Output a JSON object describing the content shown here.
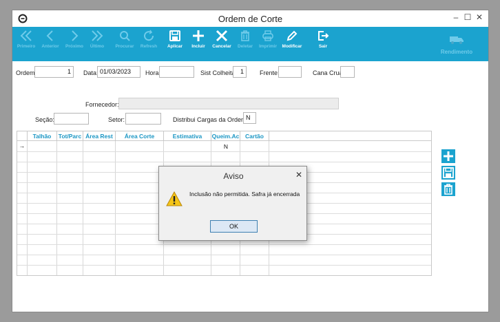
{
  "window": {
    "title": "Ordem de Corte"
  },
  "toolbar": {
    "buttons": [
      {
        "label": "Primeiro",
        "icon": "double-chevron-left-icon",
        "enabled": false
      },
      {
        "label": "Anterior",
        "icon": "chevron-left-icon",
        "enabled": false
      },
      {
        "label": "Próximo",
        "icon": "chevron-right-icon",
        "enabled": false
      },
      {
        "label": "Último",
        "icon": "double-chevron-right-icon",
        "enabled": false
      },
      {
        "label": "Procurar",
        "icon": "search-icon",
        "enabled": false
      },
      {
        "label": "Refresh",
        "icon": "refresh-icon",
        "enabled": false
      },
      {
        "label": "Aplicar",
        "icon": "save-icon",
        "enabled": true
      },
      {
        "label": "Incluir",
        "icon": "plus-icon",
        "enabled": true
      },
      {
        "label": "Cancelar",
        "icon": "x-icon",
        "enabled": true
      },
      {
        "label": "Deletar",
        "icon": "trash-icon",
        "enabled": false
      },
      {
        "label": "Imprimir",
        "icon": "printer-icon",
        "enabled": false
      },
      {
        "label": "Modificar",
        "icon": "pencil-icon",
        "enabled": true
      },
      {
        "label": "Sair",
        "icon": "exit-icon",
        "enabled": true
      }
    ],
    "brand_label": "Rendimento"
  },
  "form": {
    "ordem_label": "Ordem:",
    "ordem_value": "1",
    "data_label": "Data:",
    "data_value": "01/03/2023",
    "hora_label": "Hora:",
    "hora_value": "",
    "sist_label": "Sist Colheita:",
    "sist_value": "1",
    "frente_label": "Frente:",
    "frente_value": "",
    "cana_label": "Cana Crua:",
    "cana_value": "",
    "fornecedor_label": "Fornecedor:",
    "fornecedor_value": "",
    "secao_label": "Seção:",
    "secao_value": "",
    "setor_label": "Setor:",
    "setor_value": "",
    "distribui_label": "Distribui Cargas da Ordem:",
    "distribui_value": "N"
  },
  "grid": {
    "columns": [
      "Talhão",
      "Tot/Parc",
      "Área Rest",
      "Área Corte",
      "Estimativa",
      "Queim.Ac",
      "Cartão"
    ],
    "rows": [
      [
        "",
        "",
        "",
        "",
        "",
        "N",
        ""
      ]
    ],
    "row_indicator": "→"
  },
  "dialog": {
    "title": "Aviso",
    "message": "Inclusão não permitida. Safra já encerrada",
    "ok_label": "OK"
  },
  "colors": {
    "toolbar": "#1ba3cf",
    "header_text": "#1a96c4",
    "disabled_icon": "#6fcbea"
  }
}
